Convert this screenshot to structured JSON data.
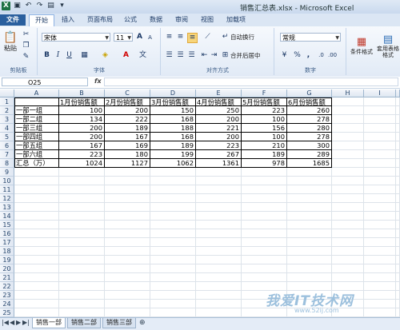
{
  "window": {
    "title": "销售汇总表.xlsx - Microsoft Excel"
  },
  "ribbon_tabs": [
    "文件",
    "开始",
    "插入",
    "页面布局",
    "公式",
    "数据",
    "审阅",
    "视图",
    "加载项"
  ],
  "active_tab": "开始",
  "clipboard": {
    "paste": "粘贴",
    "group": "剪贴板"
  },
  "font": {
    "name": "宋体",
    "size": "11",
    "group": "字体",
    "bold": "B",
    "italic": "I",
    "underline": "U",
    "grow": "A",
    "shrink": "A"
  },
  "alignment": {
    "wrap": "自动换行",
    "merge": "合并后居中",
    "group": "对齐方式"
  },
  "number": {
    "format": "常规",
    "group": "数字",
    "percent": "%",
    "comma": ","
  },
  "styles": {
    "conditional": "条件格式",
    "table": "套用表格格式"
  },
  "formula_bar": {
    "name_box": "O25",
    "fx": "fx",
    "content": ""
  },
  "columns": [
    "A",
    "B",
    "C",
    "D",
    "E",
    "F",
    "G",
    "H",
    "I"
  ],
  "rows": [
    "1",
    "2",
    "3",
    "4",
    "5",
    "6",
    "7",
    "8",
    "9",
    "10",
    "11",
    "12",
    "13",
    "14",
    "15",
    "16",
    "17",
    "18",
    "19",
    "20",
    "21",
    "22",
    "23",
    "24",
    "25"
  ],
  "table": {
    "header": [
      "",
      "1月份销售额",
      "2月份销售额",
      "3月份销售额",
      "4月份销售额",
      "5月份销售额",
      "6月份销售额"
    ],
    "body": [
      [
        "一部一组",
        "100",
        "200",
        "150",
        "250",
        "223",
        "260"
      ],
      [
        "一部二组",
        "134",
        "222",
        "168",
        "200",
        "100",
        "278"
      ],
      [
        "一部三组",
        "200",
        "189",
        "188",
        "221",
        "156",
        "280"
      ],
      [
        "一部四组",
        "200",
        "167",
        "168",
        "200",
        "100",
        "278"
      ],
      [
        "一部五组",
        "167",
        "169",
        "189",
        "223",
        "210",
        "300"
      ],
      [
        "一部六组",
        "223",
        "180",
        "199",
        "267",
        "189",
        "289"
      ],
      [
        "汇总（万）",
        "1024",
        "1127",
        "1062",
        "1361",
        "978",
        "1685"
      ]
    ]
  },
  "sheets": [
    "销售一部",
    "销售二部",
    "销售三部"
  ],
  "active_sheet": "销售一部",
  "watermark": {
    "text": "我爱IT技术网",
    "url": "www.52ij.com"
  },
  "colors": {
    "file_tab": "#2a5f9e",
    "accent": "#1e7145"
  }
}
